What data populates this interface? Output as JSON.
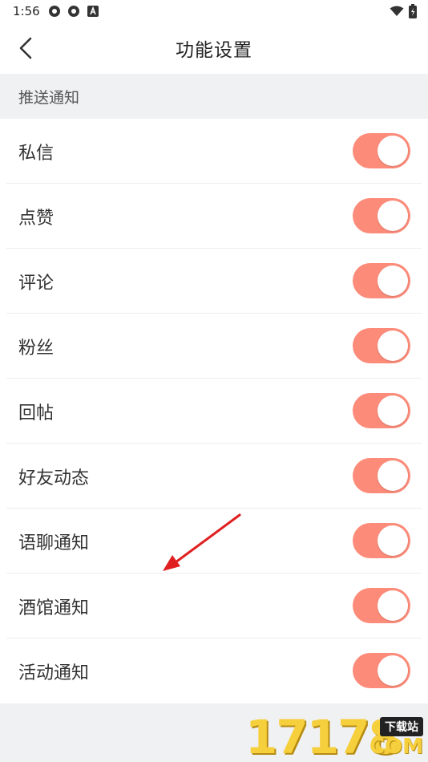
{
  "status_bar": {
    "time": "1:56"
  },
  "nav": {
    "title": "功能设置"
  },
  "section": {
    "title": "推送通知"
  },
  "settings": [
    {
      "label": "私信",
      "enabled": true
    },
    {
      "label": "点赞",
      "enabled": true
    },
    {
      "label": "评论",
      "enabled": true
    },
    {
      "label": "粉丝",
      "enabled": true
    },
    {
      "label": "回帖",
      "enabled": true
    },
    {
      "label": "好友动态",
      "enabled": true
    },
    {
      "label": "语聊通知",
      "enabled": true
    },
    {
      "label": "酒馆通知",
      "enabled": true
    },
    {
      "label": "活动通知",
      "enabled": true
    }
  ],
  "colors": {
    "toggle_on": "#fd8b79",
    "arrow": "#e02020",
    "watermark": "#f6cf3c"
  },
  "watermark": {
    "digits": "17178",
    "tag": "下载站",
    "domain": "COM"
  }
}
